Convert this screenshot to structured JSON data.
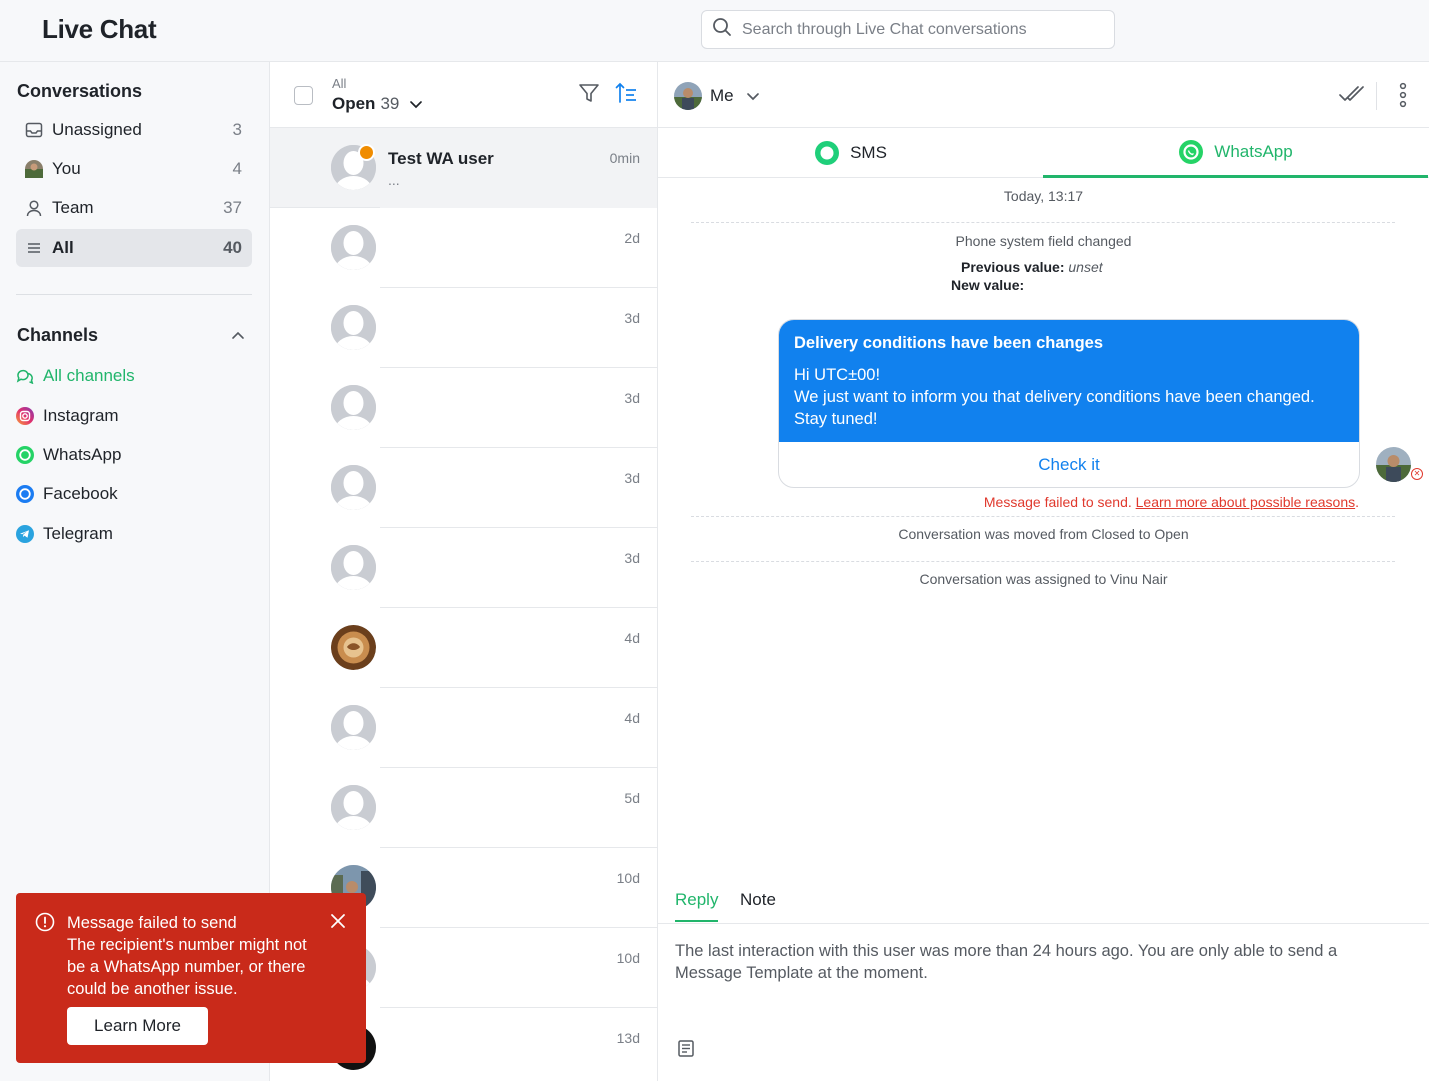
{
  "app": {
    "title": "Live Chat"
  },
  "search": {
    "placeholder": "Search through Live Chat conversations"
  },
  "sidebar": {
    "conversations_title": "Conversations",
    "items": [
      {
        "label": "Unassigned",
        "count": "3",
        "icon": "inbox-icon"
      },
      {
        "label": "You",
        "count": "4",
        "icon": "avatar"
      },
      {
        "label": "Team",
        "count": "37",
        "icon": "person-icon"
      },
      {
        "label": "All",
        "count": "40",
        "icon": "list-icon",
        "active": true
      }
    ],
    "channels_title": "Channels",
    "channels": [
      {
        "label": "All channels",
        "icon": "chat-bubbles-icon",
        "active": true
      },
      {
        "label": "Instagram",
        "icon": "instagram-icon"
      },
      {
        "label": "WhatsApp",
        "icon": "whatsapp-icon"
      },
      {
        "label": "Facebook",
        "icon": "messenger-icon"
      },
      {
        "label": "Telegram",
        "icon": "telegram-icon"
      }
    ]
  },
  "list": {
    "filter_small": "All",
    "filter_label": "Open",
    "filter_count": "39",
    "rows": [
      {
        "name": "Test WA user",
        "preview": "...",
        "time": "0min",
        "avatar": "placeholder",
        "selected": true,
        "badge": true
      },
      {
        "name": "",
        "preview": "",
        "time": "2d",
        "avatar": "placeholder"
      },
      {
        "name": "",
        "preview": "",
        "time": "3d",
        "avatar": "placeholder"
      },
      {
        "name": "",
        "preview": "",
        "time": "3d",
        "avatar": "placeholder"
      },
      {
        "name": "",
        "preview": "",
        "time": "3d",
        "avatar": "placeholder"
      },
      {
        "name": "",
        "preview": "",
        "time": "3d",
        "avatar": "placeholder"
      },
      {
        "name": "",
        "preview": "",
        "time": "4d",
        "avatar": "photo-coffee"
      },
      {
        "name": "",
        "preview": "",
        "time": "4d",
        "avatar": "placeholder"
      },
      {
        "name": "",
        "preview": "",
        "time": "5d",
        "avatar": "placeholder"
      },
      {
        "name": "",
        "preview": "",
        "time": "10d",
        "avatar": "photo-street"
      },
      {
        "name": "",
        "preview": "",
        "time": "10d",
        "avatar": "placeholder"
      },
      {
        "name": "",
        "preview": "",
        "time": "13d",
        "avatar": "photo-dark"
      }
    ]
  },
  "chat": {
    "assignee": "Me",
    "tabs": [
      {
        "label": "SMS",
        "icon": "sms-icon"
      },
      {
        "label": "WhatsApp",
        "icon": "whatsapp-icon",
        "active": true
      }
    ],
    "day_separator": "Today, 13:17",
    "system_change": {
      "title": "Phone system field changed",
      "prev_label": "Previous value:",
      "prev_value": "unset",
      "new_label": "New value:"
    },
    "message": {
      "title": "Delivery conditions have been changes",
      "lines": [
        "Hi UTC±00!",
        "We just want to inform you that delivery conditions have been changed.",
        "Stay tuned!"
      ],
      "button": "Check it",
      "error": "Message failed to send.",
      "error_link": "Learn more about possible reasons"
    },
    "events": [
      "Conversation was moved from Closed to Open",
      "Conversation was assigned to Vinu Nair"
    ],
    "composer": {
      "tabs": [
        "Reply",
        "Note"
      ],
      "notice": "The last interaction with this user was more than 24 hours ago. You are only able to send a Message Template at the moment."
    }
  },
  "toast": {
    "title": "Message failed to send",
    "body": "The recipient's number might not be a WhatsApp number, or there could be another issue.",
    "button": "Learn More"
  },
  "colors": {
    "accent_green": "#21b56b",
    "bubble_blue": "#1181ee",
    "error_red": "#e0392d",
    "toast_red": "#c92a1a"
  }
}
